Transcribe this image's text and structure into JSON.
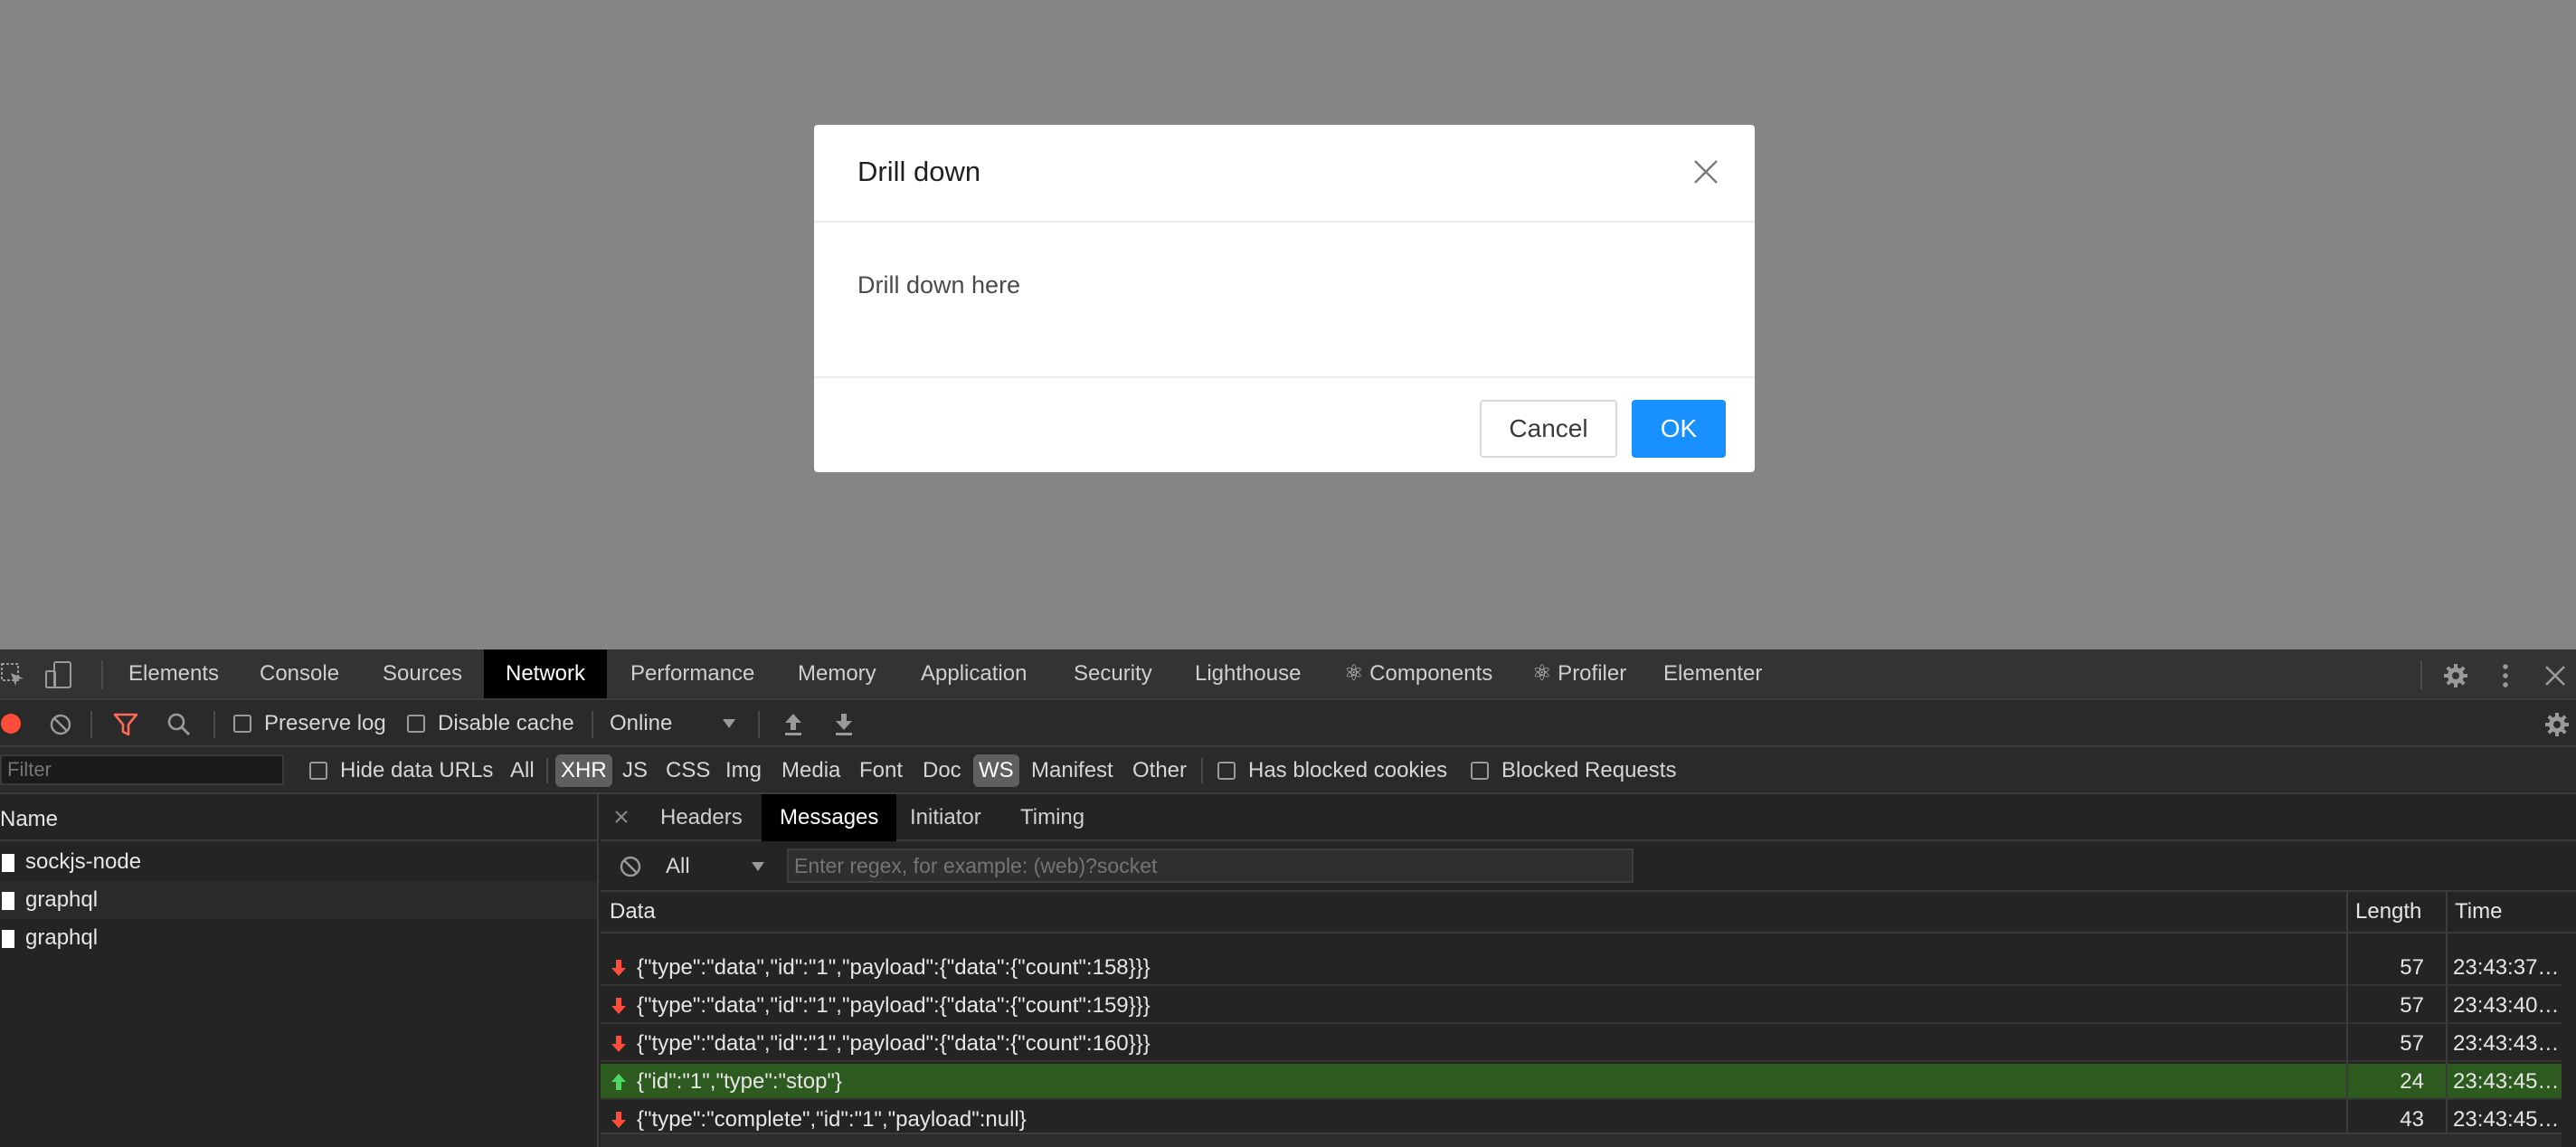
{
  "modal": {
    "title": "Drill down",
    "body": "Drill down here",
    "cancel_label": "Cancel",
    "ok_label": "OK",
    "primary_color": "#1890ff"
  },
  "devtools": {
    "tabs": [
      "Elements",
      "Console",
      "Sources",
      "Network",
      "Performance",
      "Memory",
      "Application",
      "Security",
      "Lighthouse",
      "⚛ Components",
      "⚛ Profiler",
      "Elementer"
    ],
    "active_tab": "Network",
    "toolbar": {
      "preserve_log": "Preserve log",
      "disable_cache": "Disable cache",
      "throttle": "Online"
    },
    "filterbar": {
      "filter_placeholder": "Filter",
      "hide_data_urls": "Hide data URLs",
      "types": [
        "All",
        "XHR",
        "JS",
        "CSS",
        "Img",
        "Media",
        "Font",
        "Doc",
        "WS",
        "Manifest",
        "Other"
      ],
      "active_types": [
        "XHR",
        "WS"
      ],
      "has_blocked_cookies": "Has blocked cookies",
      "blocked_requests": "Blocked Requests"
    },
    "requests": {
      "header": "Name",
      "items": [
        "sockjs-node",
        "graphql",
        "graphql"
      ]
    },
    "detail": {
      "tabs": [
        "Headers",
        "Messages",
        "Initiator",
        "Timing"
      ],
      "active_tab": "Messages",
      "message_filter": "All",
      "regex_placeholder": "Enter regex, for example: (web)?socket",
      "columns": {
        "data": "Data",
        "length": "Length",
        "time": "Time"
      },
      "messages": [
        {
          "direction": "received",
          "data": "{\"type\":\"data\",\"id\":\"1\",\"payload\":{\"data\":{\"count\":158}}}",
          "length": "57",
          "time": "23:43:37…"
        },
        {
          "direction": "received",
          "data": "{\"type\":\"data\",\"id\":\"1\",\"payload\":{\"data\":{\"count\":159}}}",
          "length": "57",
          "time": "23:43:40…"
        },
        {
          "direction": "received",
          "data": "{\"type\":\"data\",\"id\":\"1\",\"payload\":{\"data\":{\"count\":160}}}",
          "length": "57",
          "time": "23:43:43…"
        },
        {
          "direction": "sent",
          "data": "{\"id\":\"1\",\"type\":\"stop\"}",
          "length": "24",
          "time": "23:43:45…"
        },
        {
          "direction": "received",
          "data": "{\"type\":\"complete\",\"id\":\"1\",\"payload\":null}",
          "length": "43",
          "time": "23:43:45…"
        }
      ]
    },
    "colors": {
      "received_arrow": "#ff4d3a",
      "sent_arrow": "#4cd964",
      "sent_row_bg": "#2d5a1f",
      "record_dot": "#ff4d3a",
      "filter_icon": "#ff6b57"
    }
  }
}
